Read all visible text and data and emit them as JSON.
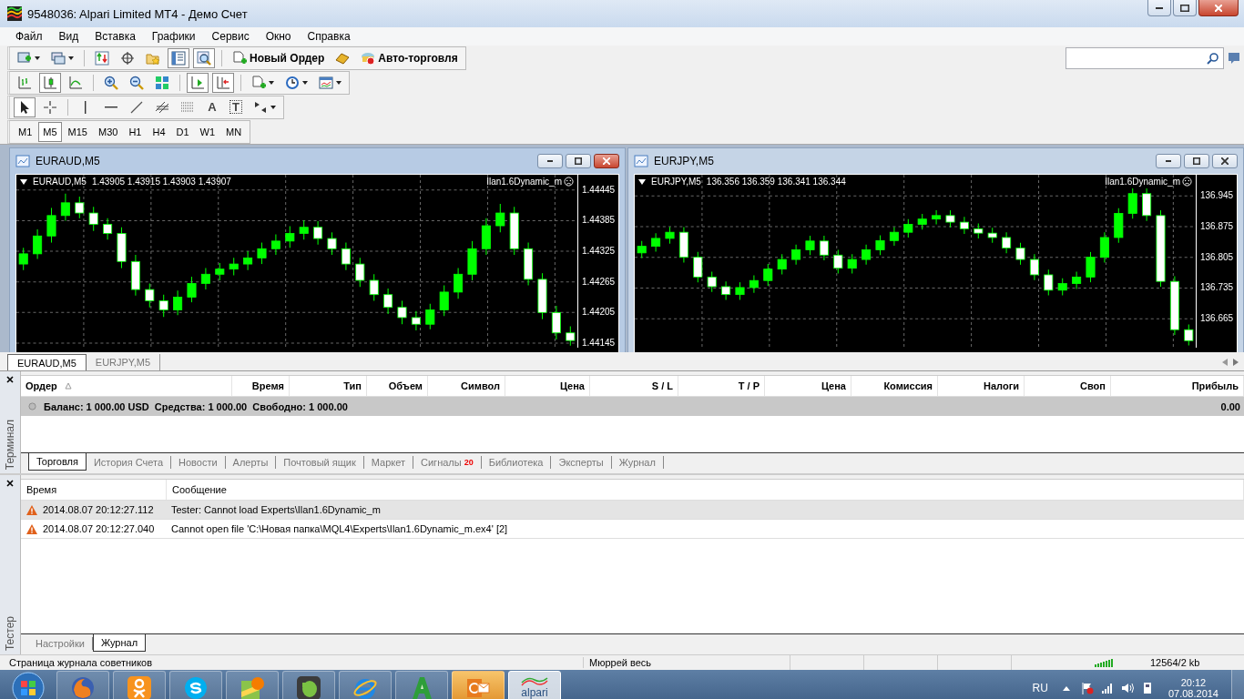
{
  "window": {
    "title": "9548036: Alpari Limited MT4 - Демо Счет"
  },
  "menu": [
    "Файл",
    "Вид",
    "Вставка",
    "Графики",
    "Сервис",
    "Окно",
    "Справка"
  ],
  "toolbar_main": [
    [
      {
        "kind": "new-chart",
        "dropdown": true,
        "selected": false
      },
      {
        "kind": "profiles",
        "dropdown": true,
        "selected": false
      }
    ],
    [
      {
        "kind": "market-watch",
        "dropdown": false,
        "selected": false
      },
      {
        "kind": "navigator",
        "dropdown": false,
        "selected": false
      },
      {
        "kind": "favorites",
        "dropdown": false,
        "selected": false
      },
      {
        "kind": "data-window",
        "dropdown": false,
        "selected": true
      },
      {
        "kind": "tester",
        "dropdown": false,
        "selected": true
      }
    ],
    [
      {
        "kind": "order",
        "label": "Новый Ордер",
        "dropdown": false,
        "selected": false
      },
      {
        "kind": "gold",
        "dropdown": false,
        "selected": false
      },
      {
        "kind": "autotrade",
        "label": "Авто-торговля",
        "dropdown": false,
        "selected": false
      }
    ]
  ],
  "toolbar_charts": [
    [
      {
        "kind": "bar-chart",
        "dropdown": false,
        "selected": false
      },
      {
        "kind": "candle-chart",
        "dropdown": false,
        "selected": true
      },
      {
        "kind": "line-chart",
        "dropdown": false,
        "selected": false
      }
    ],
    [
      {
        "kind": "zoom-in",
        "dropdown": false,
        "selected": false
      },
      {
        "kind": "zoom-out",
        "dropdown": false,
        "selected": false
      },
      {
        "kind": "tile",
        "dropdown": false,
        "selected": false
      }
    ],
    [
      {
        "kind": "chart-shift",
        "dropdown": false,
        "selected": true
      },
      {
        "kind": "autoscroll",
        "dropdown": false,
        "selected": true
      }
    ],
    [
      {
        "kind": "indicators",
        "dropdown": true,
        "selected": false
      },
      {
        "kind": "periods",
        "dropdown": true,
        "selected": false
      },
      {
        "kind": "templates",
        "dropdown": true,
        "selected": false
      }
    ]
  ],
  "toolbar_draw": [
    [
      {
        "kind": "cursor",
        "dropdown": false,
        "selected": true
      },
      {
        "kind": "crosshair",
        "dropdown": false,
        "selected": false
      }
    ],
    [
      {
        "kind": "vline",
        "dropdown": false,
        "selected": false
      },
      {
        "kind": "hline",
        "dropdown": false,
        "selected": false
      },
      {
        "kind": "trendline",
        "dropdown": false,
        "selected": false
      },
      {
        "kind": "channel",
        "dropdown": false,
        "selected": false
      },
      {
        "kind": "fibo",
        "dropdown": false,
        "selected": false
      },
      {
        "kind": "text",
        "glyph": "A",
        "dropdown": false,
        "selected": false
      },
      {
        "kind": "label",
        "glyph": "T",
        "dropdown": false,
        "selected": false
      },
      {
        "kind": "arrows",
        "dropdown": true,
        "selected": false
      }
    ]
  ],
  "timeframes": [
    {
      "label": "M1",
      "selected": false
    },
    {
      "label": "M5",
      "selected": true
    },
    {
      "label": "M15",
      "selected": false
    },
    {
      "label": "M30",
      "selected": false
    },
    {
      "label": "H1",
      "selected": false
    },
    {
      "label": "H4",
      "selected": false
    },
    {
      "label": "D1",
      "selected": false
    },
    {
      "label": "W1",
      "selected": false
    },
    {
      "label": "MN",
      "selected": false
    }
  ],
  "charts": [
    {
      "title": "EURAUD,M5",
      "active": true,
      "symbol": "EURAUD,M5",
      "prices": "1.43905 1.43915 1.43903 1.43907",
      "expert": "Ilan1.6Dynamic_m",
      "chart_data": {
        "type": "candlestick",
        "categories": [
          null,
          null,
          null,
          null,
          null,
          null,
          null,
          null,
          null,
          null,
          null,
          null,
          null,
          null,
          null,
          null,
          null,
          null,
          null,
          null,
          null,
          null,
          null,
          null,
          null,
          null,
          null,
          null,
          null,
          null,
          null,
          null,
          null,
          null,
          null,
          null,
          null,
          null,
          null,
          null
        ],
        "grid": true,
        "ylim": [
          1.44136,
          1.44475
        ],
        "yticks": [
          {
            "value": 1.44445,
            "label": "1.44445"
          },
          {
            "value": 1.44385,
            "label": "1.44385"
          },
          {
            "value": 1.44325,
            "label": "1.44325"
          },
          {
            "value": 1.44265,
            "label": "1.44265"
          },
          {
            "value": 1.44205,
            "label": "1.44205"
          },
          {
            "value": 1.44145,
            "label": "1.44145"
          }
        ],
        "series": [
          {
            "color": "#00ff00",
            "ohlc": [
              [
                1.443,
                1.44332,
                1.44288,
                1.4432
              ],
              [
                1.4432,
                1.44368,
                1.4431,
                1.44355
              ],
              [
                1.44355,
                1.4441,
                1.44342,
                1.44395
              ],
              [
                1.44395,
                1.44438,
                1.44385,
                1.4442
              ],
              [
                1.4442,
                1.44432,
                1.4439,
                1.444
              ],
              [
                1.444,
                1.44412,
                1.44365,
                1.44378
              ],
              [
                1.44378,
                1.4439,
                1.44348,
                1.4436
              ],
              [
                1.4436,
                1.44372,
                1.44292,
                1.44305
              ],
              [
                1.44305,
                1.44318,
                1.44238,
                1.4425
              ],
              [
                1.4425,
                1.44262,
                1.44215,
                1.44228
              ],
              [
                1.44228,
                1.4424,
                1.44196,
                1.4421
              ],
              [
                1.4421,
                1.44248,
                1.442,
                1.44235
              ],
              [
                1.44235,
                1.44275,
                1.44225,
                1.44262
              ],
              [
                1.44262,
                1.44292,
                1.4425,
                1.4428
              ],
              [
                1.4428,
                1.44302,
                1.44268,
                1.4429
              ],
              [
                1.4429,
                1.44312,
                1.44278,
                1.443
              ],
              [
                1.443,
                1.44325,
                1.44288,
                1.44312
              ],
              [
                1.44312,
                1.44342,
                1.443,
                1.4433
              ],
              [
                1.4433,
                1.44358,
                1.44318,
                1.44345
              ],
              [
                1.44345,
                1.44374,
                1.44332,
                1.4436
              ],
              [
                1.4436,
                1.44386,
                1.44348,
                1.44372
              ],
              [
                1.44372,
                1.44384,
                1.44338,
                1.4435
              ],
              [
                1.4435,
                1.44362,
                1.44318,
                1.4433
              ],
              [
                1.4433,
                1.44342,
                1.44288,
                1.443
              ],
              [
                1.443,
                1.44312,
                1.44255,
                1.44268
              ],
              [
                1.44268,
                1.4428,
                1.44228,
                1.4424
              ],
              [
                1.4424,
                1.44252,
                1.44202,
                1.44215
              ],
              [
                1.44215,
                1.44228,
                1.44182,
                1.44195
              ],
              [
                1.44195,
                1.44208,
                1.4417,
                1.44182
              ],
              [
                1.44182,
                1.44222,
                1.44172,
                1.4421
              ],
              [
                1.4421,
                1.44258,
                1.44198,
                1.44245
              ],
              [
                1.44245,
                1.44292,
                1.44232,
                1.4428
              ],
              [
                1.4428,
                1.44345,
                1.44268,
                1.4433
              ],
              [
                1.4433,
                1.4439,
                1.44318,
                1.44375
              ],
              [
                1.44375,
                1.44418,
                1.44362,
                1.444
              ],
              [
                1.444,
                1.44412,
                1.44318,
                1.4433
              ],
              [
                1.4433,
                1.44342,
                1.44258,
                1.4427
              ],
              [
                1.4427,
                1.44282,
                1.44192,
                1.44205
              ],
              [
                1.44205,
                1.44218,
                1.44152,
                1.44165
              ],
              [
                1.44165,
                1.44178,
                1.4414,
                1.4415
              ]
            ]
          }
        ]
      }
    },
    {
      "title": "EURJPY,M5",
      "active": false,
      "symbol": "EURJPY,M5",
      "prices": "136.356 136.359 136.341 136.344",
      "expert": "Ilan1.6Dynamic_m",
      "chart_data": {
        "type": "candlestick",
        "categories": [
          null,
          null,
          null,
          null,
          null,
          null,
          null,
          null,
          null,
          null,
          null,
          null,
          null,
          null,
          null,
          null,
          null,
          null,
          null,
          null,
          null,
          null,
          null,
          null,
          null,
          null,
          null,
          null,
          null,
          null,
          null,
          null,
          null,
          null,
          null,
          null,
          null,
          null,
          null,
          null
        ],
        "grid": true,
        "ylim": [
          136.599,
          136.993
        ],
        "yticks": [
          {
            "value": 136.945,
            "label": "136.945"
          },
          {
            "value": 136.875,
            "label": "136.875"
          },
          {
            "value": 136.805,
            "label": "136.805"
          },
          {
            "value": 136.735,
            "label": "136.735"
          },
          {
            "value": 136.665,
            "label": "136.665"
          }
        ],
        "series": [
          {
            "color": "#00ff00",
            "ohlc": [
              [
                136.815,
                136.842,
                136.803,
                136.83
              ],
              [
                136.83,
                136.86,
                136.818,
                136.848
              ],
              [
                136.848,
                136.874,
                136.836,
                136.862
              ],
              [
                136.862,
                136.874,
                136.793,
                136.805
              ],
              [
                136.805,
                136.817,
                136.748,
                136.76
              ],
              [
                136.76,
                136.772,
                136.726,
                136.738
              ],
              [
                136.738,
                136.75,
                136.708,
                136.72
              ],
              [
                136.72,
                136.748,
                136.708,
                136.736
              ],
              [
                136.736,
                136.764,
                136.724,
                136.752
              ],
              [
                136.752,
                136.79,
                136.74,
                136.778
              ],
              [
                136.778,
                136.812,
                136.766,
                136.8
              ],
              [
                136.8,
                136.834,
                136.788,
                136.822
              ],
              [
                136.822,
                136.854,
                136.81,
                136.842
              ],
              [
                136.842,
                136.854,
                136.798,
                136.81
              ],
              [
                136.81,
                136.822,
                136.768,
                136.78
              ],
              [
                136.78,
                136.812,
                136.768,
                136.8
              ],
              [
                136.8,
                136.834,
                136.788,
                136.822
              ],
              [
                136.822,
                136.855,
                136.81,
                136.843
              ],
              [
                136.843,
                136.874,
                136.831,
                136.862
              ],
              [
                136.862,
                136.892,
                136.85,
                136.88
              ],
              [
                136.88,
                136.904,
                136.868,
                136.892
              ],
              [
                136.892,
                136.912,
                136.88,
                136.9
              ],
              [
                136.9,
                136.912,
                136.873,
                136.885
              ],
              [
                136.885,
                136.897,
                136.858,
                136.87
              ],
              [
                136.87,
                136.882,
                136.848,
                136.86
              ],
              [
                136.86,
                136.872,
                136.838,
                136.85
              ],
              [
                136.85,
                136.862,
                136.814,
                136.826
              ],
              [
                136.826,
                136.838,
                136.788,
                136.8
              ],
              [
                136.8,
                136.812,
                136.753,
                136.765
              ],
              [
                136.765,
                136.777,
                136.718,
                136.73
              ],
              [
                136.73,
                136.757,
                136.718,
                136.745
              ],
              [
                136.745,
                136.772,
                136.733,
                136.76
              ],
              [
                136.76,
                136.817,
                136.748,
                136.805
              ],
              [
                136.805,
                136.862,
                136.793,
                136.85
              ],
              [
                136.85,
                136.917,
                136.838,
                136.905
              ],
              [
                136.905,
                136.962,
                136.893,
                136.95
              ],
              [
                136.95,
                136.962,
                136.888,
                136.9
              ],
              [
                136.9,
                136.912,
                136.738,
                136.75
              ],
              [
                136.75,
                136.762,
                136.628,
                136.64
              ],
              [
                136.64,
                136.652,
                136.604,
                136.615
              ]
            ]
          }
        ]
      }
    }
  ],
  "chart_tabs": [
    {
      "label": "EURAUD,M5",
      "selected": true
    },
    {
      "label": "EURJPY,M5",
      "selected": false
    }
  ],
  "terminal": {
    "side_label": "Терминал",
    "columns": [
      "Ордер",
      "Время",
      "Тип",
      "Объем",
      "Символ",
      "Цена",
      "S / L",
      "T / P",
      "Цена",
      "Комиссия",
      "Налоги",
      "Своп",
      "Прибыль"
    ],
    "balance": "Баланс: 1 000.00 USD  Средства: 1 000.00  Свободно: 1 000.00",
    "profit": "0.00",
    "tabs": [
      {
        "label": "Торговля",
        "selected": true
      },
      {
        "label": "История Счета",
        "selected": false
      },
      {
        "label": "Новости",
        "selected": false
      },
      {
        "label": "Алерты",
        "selected": false
      },
      {
        "label": "Почтовый ящик",
        "selected": false
      },
      {
        "label": "Маркет",
        "selected": false
      },
      {
        "label": "Сигналы",
        "badge": "20",
        "selected": false
      },
      {
        "label": "Библиотека",
        "selected": false
      },
      {
        "label": "Эксперты",
        "selected": false
      },
      {
        "label": "Журнал",
        "selected": false
      }
    ]
  },
  "tester": {
    "side_label": "Тестер",
    "columns": [
      "Время",
      "Сообщение"
    ],
    "rows": [
      {
        "time": "2014.08.07 20:12:27.112",
        "message": "Tester: Cannot load Experts\\Ilan1.6Dynamic_m",
        "selected": true
      },
      {
        "time": "2014.08.07 20:12:27.040",
        "message": "Cannot open file 'C:\\Новая папка\\MQL4\\Experts\\Ilan1.6Dynamic_m.ex4' [2]",
        "selected": false
      }
    ],
    "tabs": [
      {
        "label": "Настройки",
        "selected": false
      },
      {
        "label": "Журнал",
        "selected": true
      }
    ]
  },
  "status_bar": {
    "hint": "Страница журнала советников",
    "template": "Мюррей весь",
    "traffic": "12564/2 kb"
  },
  "taskbar": {
    "apps": [
      {
        "kind": "firefox",
        "selected": false,
        "flashing": false
      },
      {
        "kind": "ok",
        "selected": false,
        "flashing": false
      },
      {
        "kind": "skype",
        "selected": false,
        "flashing": false
      },
      {
        "kind": "maps",
        "selected": false,
        "flashing": false
      },
      {
        "kind": "evernote",
        "selected": false,
        "flashing": false
      },
      {
        "kind": "ie",
        "selected": false,
        "flashing": false
      },
      {
        "kind": "a-app",
        "selected": false,
        "flashing": false
      },
      {
        "kind": "outlook",
        "selected": false,
        "flashing": true
      },
      {
        "kind": "alpari",
        "label": "alpari",
        "selected": true,
        "flashing": false
      }
    ],
    "language": "RU",
    "time": "20:12",
    "date": "07.08.2014"
  }
}
